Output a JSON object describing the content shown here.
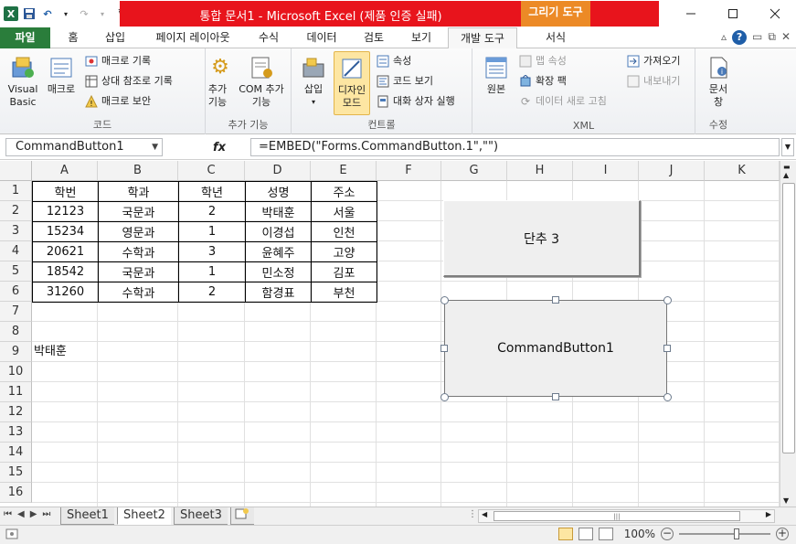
{
  "window": {
    "title": "통합 문서1  -  Microsoft Excel (제품 인증 실패)",
    "contextual_tab_group": "그리기 도구"
  },
  "tabs": [
    {
      "label": "파일"
    },
    {
      "label": "홈"
    },
    {
      "label": "삽입"
    },
    {
      "label": "페이지 레이아웃"
    },
    {
      "label": "수식"
    },
    {
      "label": "데이터"
    },
    {
      "label": "검토"
    },
    {
      "label": "보기"
    },
    {
      "label": "개발 도구"
    },
    {
      "label": "서식"
    }
  ],
  "ribbon": {
    "code": {
      "label": "코드",
      "visual_basic": "Visual Basic",
      "macro": "매크로",
      "record_macro": "매크로 기록",
      "relative_ref": "상대 참조로 기록",
      "macro_security": "매크로 보안"
    },
    "addins": {
      "label": "추가 기능",
      "addins": "추가 기능",
      "com_addins": "COM 추가 기능"
    },
    "controls": {
      "label": "컨트롤",
      "insert": "삽입",
      "design_mode": "디자인 모드",
      "properties": "속성",
      "view_code": "코드 보기",
      "run_dialog": "대화 상자 실행"
    },
    "xml": {
      "label": "XML",
      "source": "원본",
      "map_properties": "맵 속성",
      "expansion_packs": "확장 팩",
      "refresh_data": "데이터 새로 고침",
      "import": "가져오기",
      "export": "내보내기"
    },
    "modify": {
      "label": "수정",
      "doc_panel": "문서 창"
    }
  },
  "formula_bar": {
    "name_box": "CommandButton1",
    "fx": "fx",
    "formula": "=EMBED(\"Forms.CommandButton.1\",\"\")"
  },
  "columns": [
    "A",
    "B",
    "C",
    "D",
    "E",
    "F",
    "G",
    "H",
    "I",
    "J",
    "K"
  ],
  "rows": [
    "1",
    "2",
    "3",
    "4",
    "5",
    "6",
    "7",
    "8",
    "9",
    "10",
    "11",
    "12",
    "13",
    "14",
    "15",
    "16"
  ],
  "table": {
    "header": [
      "학번",
      "학과",
      "학년",
      "성명",
      "주소"
    ],
    "rows": [
      [
        "12123",
        "국문과",
        "2",
        "박태훈",
        "서울"
      ],
      [
        "15234",
        "영문과",
        "1",
        "이경섭",
        "인천"
      ],
      [
        "20621",
        "수학과",
        "3",
        "윤혜주",
        "고양"
      ],
      [
        "18542",
        "국문과",
        "1",
        "민소정",
        "김포"
      ],
      [
        "31260",
        "수학과",
        "2",
        "함경표",
        "부천"
      ]
    ]
  },
  "cell_a9": "박태훈",
  "buttons": {
    "button1": "단추 3",
    "button2": "CommandButton1"
  },
  "sheets": [
    "Sheet1",
    "Sheet2",
    "Sheet3"
  ],
  "active_sheet": "Sheet2",
  "status": {
    "zoom": "100%"
  }
}
